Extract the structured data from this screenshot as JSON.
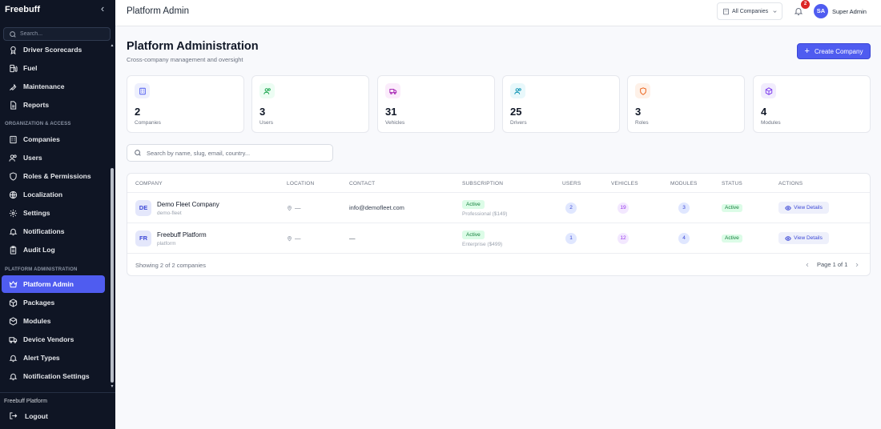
{
  "app": {
    "brand": "Freebuff",
    "search_placeholder": "Search..."
  },
  "sidebar": {
    "items_top": [
      {
        "label": "Driver Scorecards",
        "icon": "award-icon"
      },
      {
        "label": "Fuel",
        "icon": "fuel-icon"
      },
      {
        "label": "Maintenance",
        "icon": "wrench-icon"
      },
      {
        "label": "Reports",
        "icon": "file-icon"
      }
    ],
    "section_org": "ORGANIZATION & ACCESS",
    "items_org": [
      {
        "label": "Companies",
        "icon": "building-icon"
      },
      {
        "label": "Users",
        "icon": "users-icon"
      },
      {
        "label": "Roles & Permissions",
        "icon": "shield-icon"
      },
      {
        "label": "Localization",
        "icon": "globe-icon"
      },
      {
        "label": "Settings",
        "icon": "gear-icon"
      },
      {
        "label": "Notifications",
        "icon": "bell-icon"
      },
      {
        "label": "Audit Log",
        "icon": "clipboard-icon"
      }
    ],
    "section_platform": "PLATFORM ADMINISTRATION",
    "items_platform": [
      {
        "label": "Platform Admin",
        "icon": "crown-icon",
        "active": true
      },
      {
        "label": "Packages",
        "icon": "package-icon"
      },
      {
        "label": "Modules",
        "icon": "box-icon"
      },
      {
        "label": "Device Vendors",
        "icon": "truck-icon"
      },
      {
        "label": "Alert Types",
        "icon": "bell-icon"
      },
      {
        "label": "Notification Settings",
        "icon": "bell-icon"
      }
    ],
    "footer_org": "Freebuff Platform",
    "logout": "Logout"
  },
  "topbar": {
    "title": "Platform Admin",
    "company_select": "All Companies",
    "notification_count": "2",
    "avatar_initials": "SA",
    "user_name": "Super Admin"
  },
  "main": {
    "title": "Platform Administration",
    "subtitle": "Cross-company management and oversight",
    "create_button": "Create Company",
    "stats": [
      {
        "value": "2",
        "label": "Companies",
        "icon": "building-icon",
        "color": "#4f5cf0",
        "bg": "#eef0fd"
      },
      {
        "value": "3",
        "label": "Users",
        "icon": "users-icon",
        "color": "#16a34a",
        "bg": "#ecfdf3"
      },
      {
        "value": "31",
        "label": "Vehicles",
        "icon": "truck-icon",
        "color": "#a21caf",
        "bg": "#fbecfb"
      },
      {
        "value": "25",
        "label": "Drivers",
        "icon": "users-icon",
        "color": "#0891b2",
        "bg": "#e8f8fb"
      },
      {
        "value": "3",
        "label": "Roles",
        "icon": "shield-icon",
        "color": "#ea580c",
        "bg": "#fef1e8"
      },
      {
        "value": "4",
        "label": "Modules",
        "icon": "box-icon",
        "color": "#7c3aed",
        "bg": "#f1ecfd"
      }
    ],
    "filter_placeholder": "Search by name, slug, email, country...",
    "table": {
      "headers": [
        "COMPANY",
        "LOCATION",
        "CONTACT",
        "SUBSCRIPTION",
        "USERS",
        "VEHICLES",
        "MODULES",
        "STATUS",
        "ACTIONS"
      ],
      "rows": [
        {
          "initials": "DE",
          "name": "Demo Fleet Company",
          "slug": "demo-fleet",
          "location": "—",
          "contact": "info@demofleet.com",
          "subscription_status": "Active",
          "plan": "Professional ($149)",
          "users": "2",
          "vehicles": "19",
          "modules": "3",
          "status": "Active",
          "action": "View Details"
        },
        {
          "initials": "FR",
          "name": "Freebuff Platform",
          "slug": "platform",
          "location": "—",
          "contact": "—",
          "subscription_status": "Active",
          "plan": "Enterprise ($499)",
          "users": "1",
          "vehicles": "12",
          "modules": "4",
          "status": "Active",
          "action": "View Details"
        }
      ],
      "footer": "Showing 2 of 2 companies",
      "pager": "Page 1 of 1"
    }
  }
}
